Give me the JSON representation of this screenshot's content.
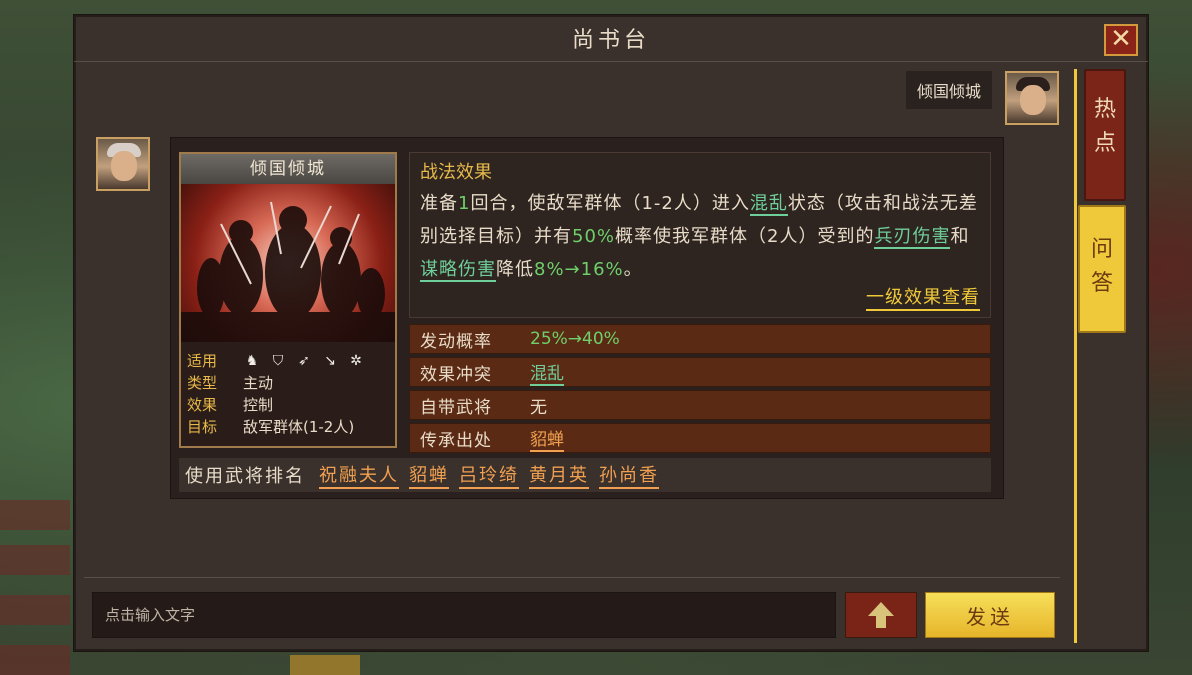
{
  "dialog": {
    "title": "尚书台",
    "close_icon": "close-icon"
  },
  "tabs": [
    {
      "label": "热\n点"
    },
    {
      "label": "问\n答"
    }
  ],
  "question": {
    "text": "倾国倾城"
  },
  "skill": {
    "name": "倾国倾城",
    "meta": {
      "applicable_label": "适用",
      "applicable_icons": [
        "cavalry-icon",
        "shield-icon",
        "bow-icon",
        "spear-icon",
        "wheel-icon"
      ],
      "type_label": "类型",
      "type_value": "主动",
      "effect_label": "效果",
      "effect_value": "控制",
      "target_label": "目标",
      "target_value": "敌军群体(1-2人)"
    },
    "effect_title": "战法效果",
    "effect_text": {
      "p1": "准备",
      "p2": "1",
      "p3": "回合，使敌军群体（1-2人）进入",
      "p4": "混乱",
      "p5": "状态（攻击和战法无差别选择目标）并有",
      "p6": "50%",
      "p7": "概率使我军群体（2人）受到的",
      "p8": "兵刃伤害",
      "p9": "和",
      "p10": "谋略伤害",
      "p11": "降低",
      "p12": "8%→16%",
      "p13": "。"
    },
    "level_link": "一级效果查看",
    "info": [
      {
        "key": "发动概率",
        "value": "25%→40%"
      },
      {
        "key": "效果冲突",
        "value": "混乱"
      },
      {
        "key": "自带武将",
        "value": "无"
      },
      {
        "key": "传承出处",
        "value": "貂蝉"
      }
    ],
    "rank_label": "使用武将排名",
    "rank_names": [
      "祝融夫人",
      "貂蝉",
      "吕玲绮",
      "黄月英",
      "孙尚香"
    ]
  },
  "input": {
    "placeholder": "点击输入文字",
    "send_label": "发送"
  },
  "colors": {
    "accent_yellow": "#f0c93a",
    "green_text": "#6fcf6a",
    "orange_link": "#f0a050",
    "tab_red": "#7a2518"
  }
}
